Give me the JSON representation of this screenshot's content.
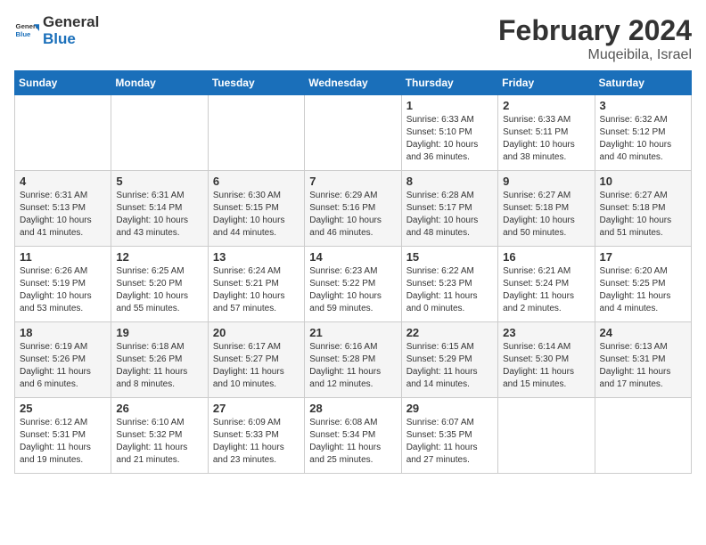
{
  "header": {
    "logo_general": "General",
    "logo_blue": "Blue",
    "month": "February 2024",
    "location": "Muqeibila, Israel"
  },
  "weekdays": [
    "Sunday",
    "Monday",
    "Tuesday",
    "Wednesday",
    "Thursday",
    "Friday",
    "Saturday"
  ],
  "weeks": [
    [
      {
        "day": "",
        "info": ""
      },
      {
        "day": "",
        "info": ""
      },
      {
        "day": "",
        "info": ""
      },
      {
        "day": "",
        "info": ""
      },
      {
        "day": "1",
        "info": "Sunrise: 6:33 AM\nSunset: 5:10 PM\nDaylight: 10 hours\nand 36 minutes."
      },
      {
        "day": "2",
        "info": "Sunrise: 6:33 AM\nSunset: 5:11 PM\nDaylight: 10 hours\nand 38 minutes."
      },
      {
        "day": "3",
        "info": "Sunrise: 6:32 AM\nSunset: 5:12 PM\nDaylight: 10 hours\nand 40 minutes."
      }
    ],
    [
      {
        "day": "4",
        "info": "Sunrise: 6:31 AM\nSunset: 5:13 PM\nDaylight: 10 hours\nand 41 minutes."
      },
      {
        "day": "5",
        "info": "Sunrise: 6:31 AM\nSunset: 5:14 PM\nDaylight: 10 hours\nand 43 minutes."
      },
      {
        "day": "6",
        "info": "Sunrise: 6:30 AM\nSunset: 5:15 PM\nDaylight: 10 hours\nand 44 minutes."
      },
      {
        "day": "7",
        "info": "Sunrise: 6:29 AM\nSunset: 5:16 PM\nDaylight: 10 hours\nand 46 minutes."
      },
      {
        "day": "8",
        "info": "Sunrise: 6:28 AM\nSunset: 5:17 PM\nDaylight: 10 hours\nand 48 minutes."
      },
      {
        "day": "9",
        "info": "Sunrise: 6:27 AM\nSunset: 5:18 PM\nDaylight: 10 hours\nand 50 minutes."
      },
      {
        "day": "10",
        "info": "Sunrise: 6:27 AM\nSunset: 5:18 PM\nDaylight: 10 hours\nand 51 minutes."
      }
    ],
    [
      {
        "day": "11",
        "info": "Sunrise: 6:26 AM\nSunset: 5:19 PM\nDaylight: 10 hours\nand 53 minutes."
      },
      {
        "day": "12",
        "info": "Sunrise: 6:25 AM\nSunset: 5:20 PM\nDaylight: 10 hours\nand 55 minutes."
      },
      {
        "day": "13",
        "info": "Sunrise: 6:24 AM\nSunset: 5:21 PM\nDaylight: 10 hours\nand 57 minutes."
      },
      {
        "day": "14",
        "info": "Sunrise: 6:23 AM\nSunset: 5:22 PM\nDaylight: 10 hours\nand 59 minutes."
      },
      {
        "day": "15",
        "info": "Sunrise: 6:22 AM\nSunset: 5:23 PM\nDaylight: 11 hours\nand 0 minutes."
      },
      {
        "day": "16",
        "info": "Sunrise: 6:21 AM\nSunset: 5:24 PM\nDaylight: 11 hours\nand 2 minutes."
      },
      {
        "day": "17",
        "info": "Sunrise: 6:20 AM\nSunset: 5:25 PM\nDaylight: 11 hours\nand 4 minutes."
      }
    ],
    [
      {
        "day": "18",
        "info": "Sunrise: 6:19 AM\nSunset: 5:26 PM\nDaylight: 11 hours\nand 6 minutes."
      },
      {
        "day": "19",
        "info": "Sunrise: 6:18 AM\nSunset: 5:26 PM\nDaylight: 11 hours\nand 8 minutes."
      },
      {
        "day": "20",
        "info": "Sunrise: 6:17 AM\nSunset: 5:27 PM\nDaylight: 11 hours\nand 10 minutes."
      },
      {
        "day": "21",
        "info": "Sunrise: 6:16 AM\nSunset: 5:28 PM\nDaylight: 11 hours\nand 12 minutes."
      },
      {
        "day": "22",
        "info": "Sunrise: 6:15 AM\nSunset: 5:29 PM\nDaylight: 11 hours\nand 14 minutes."
      },
      {
        "day": "23",
        "info": "Sunrise: 6:14 AM\nSunset: 5:30 PM\nDaylight: 11 hours\nand 15 minutes."
      },
      {
        "day": "24",
        "info": "Sunrise: 6:13 AM\nSunset: 5:31 PM\nDaylight: 11 hours\nand 17 minutes."
      }
    ],
    [
      {
        "day": "25",
        "info": "Sunrise: 6:12 AM\nSunset: 5:31 PM\nDaylight: 11 hours\nand 19 minutes."
      },
      {
        "day": "26",
        "info": "Sunrise: 6:10 AM\nSunset: 5:32 PM\nDaylight: 11 hours\nand 21 minutes."
      },
      {
        "day": "27",
        "info": "Sunrise: 6:09 AM\nSunset: 5:33 PM\nDaylight: 11 hours\nand 23 minutes."
      },
      {
        "day": "28",
        "info": "Sunrise: 6:08 AM\nSunset: 5:34 PM\nDaylight: 11 hours\nand 25 minutes."
      },
      {
        "day": "29",
        "info": "Sunrise: 6:07 AM\nSunset: 5:35 PM\nDaylight: 11 hours\nand 27 minutes."
      },
      {
        "day": "",
        "info": ""
      },
      {
        "day": "",
        "info": ""
      }
    ]
  ]
}
